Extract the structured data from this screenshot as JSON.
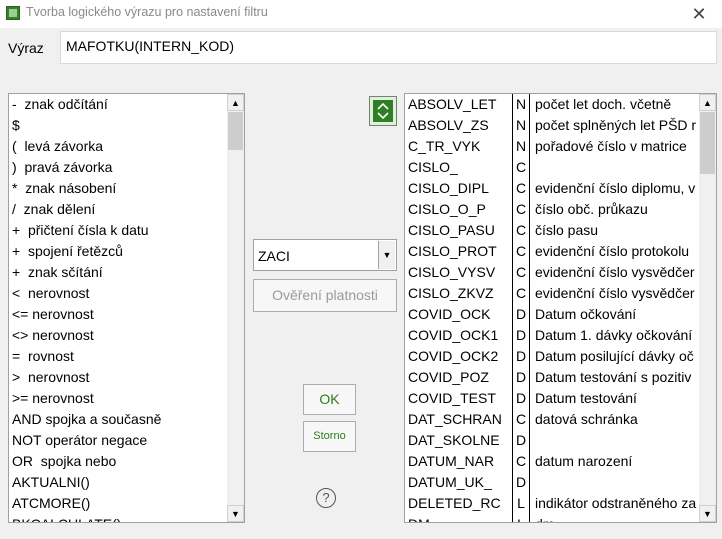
{
  "window": {
    "title": "Tvorba logického výrazu pro nastavení filtru",
    "close_symbol": "✕"
  },
  "expression": {
    "label": "Výraz",
    "value": "MAFOTKU(INTERN_KOD)"
  },
  "operators": [
    "-  znak odčítání",
    "$",
    "(  levá závorka",
    ")  pravá závorka",
    "*  znak násobení",
    "/  znak dělení",
    "+  přičtení čísla k datu",
    "+  spojení řetězců",
    "+  znak sčítání",
    "<  nerovnost",
    "<= nerovnost",
    "<> nerovnost",
    "=  rovnost",
    ">  nerovnost",
    ">= nerovnost",
    "AND spojka a současně",
    "NOT operátor negace",
    "OR  spojka nebo",
    "AKTUALNI()",
    "ATCMORE()",
    "BKCALCULATE()"
  ],
  "fields": [
    {
      "name": "ABSOLV_LET",
      "type": "N",
      "desc": "počet let doch. včetně"
    },
    {
      "name": "ABSOLV_ZS",
      "type": "N",
      "desc": "počet splněných let PŠD r"
    },
    {
      "name": "C_TR_VYK",
      "type": "N",
      "desc": "pořadové číslo v matrice"
    },
    {
      "name": "CISLO_",
      "type": "C",
      "desc": ""
    },
    {
      "name": "CISLO_DIPL",
      "type": "C",
      "desc": "evidenční číslo diplomu, v"
    },
    {
      "name": "CISLO_O_P",
      "type": "C",
      "desc": "číslo obč. průkazu"
    },
    {
      "name": "CISLO_PASU",
      "type": "C",
      "desc": "číslo pasu"
    },
    {
      "name": "CISLO_PROT",
      "type": "C",
      "desc": "evidenční číslo protokolu"
    },
    {
      "name": "CISLO_VYSV",
      "type": "C",
      "desc": "evidenční číslo vysvědčer"
    },
    {
      "name": "CISLO_ZKVZ",
      "type": "C",
      "desc": "evidenční číslo vysvědčer"
    },
    {
      "name": "COVID_OCK",
      "type": "D",
      "desc": "Datum očkování"
    },
    {
      "name": "COVID_OCK1",
      "type": "D",
      "desc": "Datum 1. dávky očkování"
    },
    {
      "name": "COVID_OCK2",
      "type": "D",
      "desc": "Datum posilující dávky oč"
    },
    {
      "name": "COVID_POZ",
      "type": "D",
      "desc": "Datum testování s pozitiv"
    },
    {
      "name": "COVID_TEST",
      "type": "D",
      "desc": "Datum testování"
    },
    {
      "name": "DAT_SCHRAN",
      "type": "C",
      "desc": "datová schránka"
    },
    {
      "name": "DAT_SKOLNE",
      "type": "D",
      "desc": ""
    },
    {
      "name": "DATUM_NAR",
      "type": "C",
      "desc": "datum narození"
    },
    {
      "name": "DATUM_UK_",
      "type": "D",
      "desc": ""
    },
    {
      "name": "DELETED_RC",
      "type": "L",
      "desc": "indikátor odstraněného za"
    },
    {
      "name": "DM",
      "type": "L",
      "desc": "dm ..."
    }
  ],
  "table_select": {
    "selected": "ZACI"
  },
  "buttons": {
    "verify": "Ověření platnosti",
    "ok": "OK",
    "storno": "Storno",
    "help": "?"
  },
  "scroll": {
    "up": "▲",
    "down": "▼"
  }
}
